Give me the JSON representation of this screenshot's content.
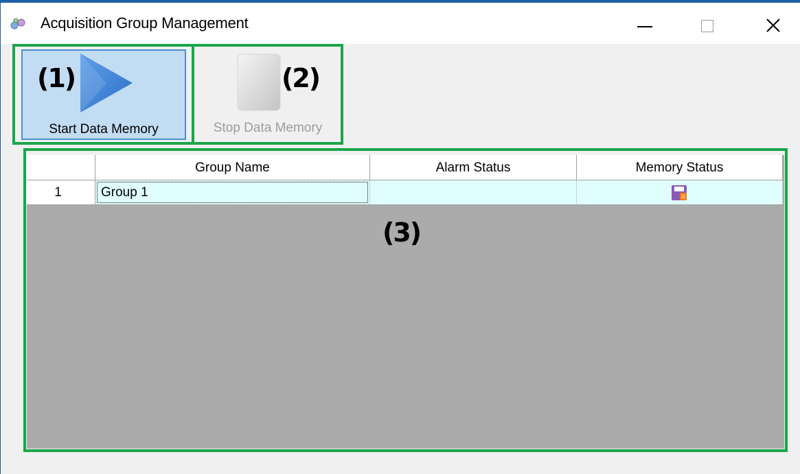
{
  "window": {
    "title": "Acquisition Group Management",
    "icon": "app-icon",
    "controls": [
      "minimize",
      "maximize",
      "close"
    ]
  },
  "toolbar": {
    "start_label": "Start Data Memory",
    "start_icon": "play-icon",
    "start_state": "selected",
    "stop_label": "Stop Data Memory",
    "stop_icon": "stop-icon",
    "stop_state": "disabled"
  },
  "callouts": {
    "one": "(1)",
    "two": "(2)",
    "three": "(3)"
  },
  "grid": {
    "headers": [
      "",
      "Group Name",
      "Alarm Status",
      "Memory Status"
    ],
    "rows": [
      {
        "num": "1",
        "name": "Group 1",
        "alarm": "",
        "memory_icon": "floppy-save-icon"
      }
    ]
  },
  "colors": {
    "callout_border": "#1aa64a",
    "selected_button_bg": "#c2dcf3",
    "row_bg": "#e0fefe",
    "grid_empty_bg": "#ababab"
  }
}
